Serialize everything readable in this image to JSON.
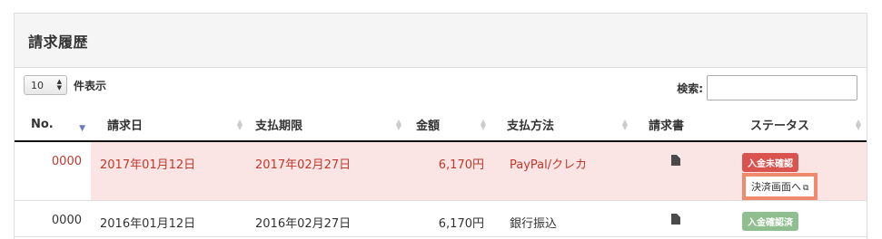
{
  "panel": {
    "title": "請求履歴"
  },
  "length": {
    "value": "10",
    "label": "件表示"
  },
  "search": {
    "label": "検索:",
    "placeholder": ""
  },
  "columns": [
    "No.",
    "請求日",
    "支払期限",
    "金額",
    "支払方法",
    "請求書",
    "ステータス"
  ],
  "rows": [
    {
      "no": "0000",
      "billing_date": "2017年01月12日",
      "due_date": "2017年02月27日",
      "amount": "6,170円",
      "method": "PayPal/クレカ",
      "status": "入金未確認",
      "action": "決済画面へ"
    },
    {
      "no": "0000",
      "billing_date": "2016年01月12日",
      "due_date": "2016年02月27日",
      "amount": "6,170円",
      "method": "銀行振込",
      "status": "入金確認済"
    }
  ],
  "colors": {
    "unpaid_bg": "#fbe4e4",
    "unpaid_text": "#c0392b",
    "badge_red": "#d9534f",
    "badge_green": "#8fbf8f",
    "highlight": "#f08a6c"
  },
  "icons": {
    "invoice": "document-icon",
    "external": "external-link-icon"
  }
}
